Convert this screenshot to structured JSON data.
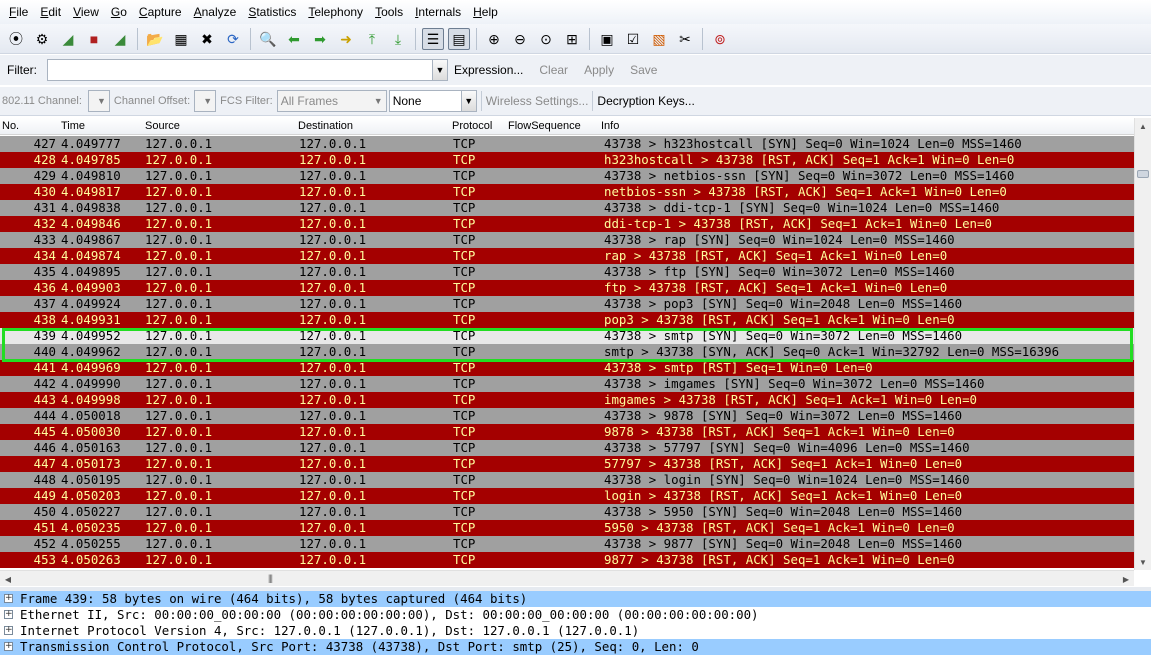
{
  "menu": [
    "File",
    "Edit",
    "View",
    "Go",
    "Capture",
    "Analyze",
    "Statistics",
    "Telephony",
    "Tools",
    "Internals",
    "Help"
  ],
  "toolbar_icons": [
    {
      "name": "interfaces-icon",
      "glyph": "⦿"
    },
    {
      "name": "options-icon",
      "glyph": "⚙"
    },
    {
      "name": "start-capture-icon",
      "glyph": "◢",
      "color": "#3a8a3a"
    },
    {
      "name": "stop-capture-icon",
      "glyph": "■",
      "color": "#b02020"
    },
    {
      "name": "restart-capture-icon",
      "glyph": "◢",
      "color": "#3a8a3a"
    },
    {
      "sep": true
    },
    {
      "name": "open-file-icon",
      "glyph": "📂"
    },
    {
      "name": "save-file-icon",
      "glyph": "▦"
    },
    {
      "name": "close-file-icon",
      "glyph": "✖"
    },
    {
      "name": "reload-icon",
      "glyph": "⟳",
      "color": "#2b66c4"
    },
    {
      "sep": true
    },
    {
      "name": "find-packet-icon",
      "glyph": "🔍"
    },
    {
      "name": "go-back-icon",
      "glyph": "⬅",
      "color": "#2f9a2f"
    },
    {
      "name": "go-forward-icon",
      "glyph": "➡",
      "color": "#2f9a2f"
    },
    {
      "name": "go-to-packet-icon",
      "glyph": "➜",
      "color": "#c9a000"
    },
    {
      "name": "first-packet-icon",
      "glyph": "⤒",
      "color": "#2f9a2f"
    },
    {
      "name": "last-packet-icon",
      "glyph": "⤓",
      "color": "#2f9a2f"
    },
    {
      "sep": true
    },
    {
      "name": "colorize-icon",
      "glyph": "☰",
      "pressed": true
    },
    {
      "name": "auto-scroll-icon",
      "glyph": "▤",
      "pressed": true
    },
    {
      "sep": true
    },
    {
      "name": "zoom-in-icon",
      "glyph": "⊕"
    },
    {
      "name": "zoom-out-icon",
      "glyph": "⊖"
    },
    {
      "name": "normal-size-icon",
      "glyph": "⊙"
    },
    {
      "name": "resize-columns-icon",
      "glyph": "⊞"
    },
    {
      "sep": true
    },
    {
      "name": "capture-filters-icon",
      "glyph": "▣"
    },
    {
      "name": "display-filters-icon",
      "glyph": "☑"
    },
    {
      "name": "coloring-rules-icon",
      "glyph": "▧",
      "color": "#d05a00"
    },
    {
      "name": "preferences-icon",
      "glyph": "✂"
    },
    {
      "sep": true
    },
    {
      "name": "help-icon",
      "glyph": "⊚",
      "color": "#c02020"
    }
  ],
  "filterbar": {
    "label": "Filter:",
    "value": "",
    "links": [
      {
        "label": "Expression...",
        "enabled": true
      },
      {
        "label": "Clear",
        "enabled": false
      },
      {
        "label": "Apply",
        "enabled": false
      },
      {
        "label": "Save",
        "enabled": false
      }
    ]
  },
  "wireless": {
    "channel_label": "802.11 Channel:",
    "offset_label": "Channel Offset:",
    "fcs_label": "FCS Filter:",
    "fcs_value": "All Frames",
    "decrypt_mode": "None",
    "settings_link": "Wireless Settings...",
    "keys_button": "Decryption Keys..."
  },
  "columns": [
    "No.",
    "Time",
    "Source",
    "Destination",
    "Protocol",
    "FlowSequence",
    "Info"
  ],
  "packets": [
    {
      "no": "427",
      "time": "4.049777",
      "src": "127.0.0.1",
      "dst": "127.0.0.1",
      "proto": "TCP",
      "info": "43738 > h323hostcall [SYN] Seq=0 Win=1024 Len=0 MSS=1460",
      "color": "gray"
    },
    {
      "no": "428",
      "time": "4.049785",
      "src": "127.0.0.1",
      "dst": "127.0.0.1",
      "proto": "TCP",
      "info": "h323hostcall > 43738 [RST, ACK] Seq=1 Ack=1 Win=0 Len=0",
      "color": "red"
    },
    {
      "no": "429",
      "time": "4.049810",
      "src": "127.0.0.1",
      "dst": "127.0.0.1",
      "proto": "TCP",
      "info": "43738 > netbios-ssn [SYN] Seq=0 Win=3072 Len=0 MSS=1460",
      "color": "gray"
    },
    {
      "no": "430",
      "time": "4.049817",
      "src": "127.0.0.1",
      "dst": "127.0.0.1",
      "proto": "TCP",
      "info": "netbios-ssn > 43738 [RST, ACK] Seq=1 Ack=1 Win=0 Len=0",
      "color": "red"
    },
    {
      "no": "431",
      "time": "4.049838",
      "src": "127.0.0.1",
      "dst": "127.0.0.1",
      "proto": "TCP",
      "info": "43738 > ddi-tcp-1 [SYN] Seq=0 Win=1024 Len=0 MSS=1460",
      "color": "gray"
    },
    {
      "no": "432",
      "time": "4.049846",
      "src": "127.0.0.1",
      "dst": "127.0.0.1",
      "proto": "TCP",
      "info": "ddi-tcp-1 > 43738 [RST, ACK] Seq=1 Ack=1 Win=0 Len=0",
      "color": "red"
    },
    {
      "no": "433",
      "time": "4.049867",
      "src": "127.0.0.1",
      "dst": "127.0.0.1",
      "proto": "TCP",
      "info": "43738 > rap [SYN] Seq=0 Win=1024 Len=0 MSS=1460",
      "color": "gray"
    },
    {
      "no": "434",
      "time": "4.049874",
      "src": "127.0.0.1",
      "dst": "127.0.0.1",
      "proto": "TCP",
      "info": "rap > 43738 [RST, ACK] Seq=1 Ack=1 Win=0 Len=0",
      "color": "red"
    },
    {
      "no": "435",
      "time": "4.049895",
      "src": "127.0.0.1",
      "dst": "127.0.0.1",
      "proto": "TCP",
      "info": "43738 > ftp [SYN] Seq=0 Win=3072 Len=0 MSS=1460",
      "color": "gray"
    },
    {
      "no": "436",
      "time": "4.049903",
      "src": "127.0.0.1",
      "dst": "127.0.0.1",
      "proto": "TCP",
      "info": "ftp > 43738 [RST, ACK] Seq=1 Ack=1 Win=0 Len=0",
      "color": "red"
    },
    {
      "no": "437",
      "time": "4.049924",
      "src": "127.0.0.1",
      "dst": "127.0.0.1",
      "proto": "TCP",
      "info": "43738 > pop3 [SYN] Seq=0 Win=2048 Len=0 MSS=1460",
      "color": "gray"
    },
    {
      "no": "438",
      "time": "4.049931",
      "src": "127.0.0.1",
      "dst": "127.0.0.1",
      "proto": "TCP",
      "info": "pop3 > 43738 [RST, ACK] Seq=1 Ack=1 Win=0 Len=0",
      "color": "red"
    },
    {
      "no": "439",
      "time": "4.049952",
      "src": "127.0.0.1",
      "dst": "127.0.0.1",
      "proto": "TCP",
      "info": "43738 > smtp [SYN] Seq=0 Win=3072 Len=0 MSS=1460",
      "color": "sel-gray"
    },
    {
      "no": "440",
      "time": "4.049962",
      "src": "127.0.0.1",
      "dst": "127.0.0.1",
      "proto": "TCP",
      "info": "smtp > 43738 [SYN, ACK] Seq=0 Ack=1 Win=32792 Len=0 MSS=16396",
      "color": "gray"
    },
    {
      "no": "441",
      "time": "4.049969",
      "src": "127.0.0.1",
      "dst": "127.0.0.1",
      "proto": "TCP",
      "info": "43738 > smtp [RST] Seq=1 Win=0 Len=0",
      "color": "red"
    },
    {
      "no": "442",
      "time": "4.049990",
      "src": "127.0.0.1",
      "dst": "127.0.0.1",
      "proto": "TCP",
      "info": "43738 > imgames [SYN] Seq=0 Win=3072 Len=0 MSS=1460",
      "color": "gray"
    },
    {
      "no": "443",
      "time": "4.049998",
      "src": "127.0.0.1",
      "dst": "127.0.0.1",
      "proto": "TCP",
      "info": "imgames > 43738 [RST, ACK] Seq=1 Ack=1 Win=0 Len=0",
      "color": "red"
    },
    {
      "no": "444",
      "time": "4.050018",
      "src": "127.0.0.1",
      "dst": "127.0.0.1",
      "proto": "TCP",
      "info": "43738 > 9878 [SYN] Seq=0 Win=3072 Len=0 MSS=1460",
      "color": "gray"
    },
    {
      "no": "445",
      "time": "4.050030",
      "src": "127.0.0.1",
      "dst": "127.0.0.1",
      "proto": "TCP",
      "info": "9878 > 43738 [RST, ACK] Seq=1 Ack=1 Win=0 Len=0",
      "color": "red"
    },
    {
      "no": "446",
      "time": "4.050163",
      "src": "127.0.0.1",
      "dst": "127.0.0.1",
      "proto": "TCP",
      "info": "43738 > 57797 [SYN] Seq=0 Win=4096 Len=0 MSS=1460",
      "color": "gray"
    },
    {
      "no": "447",
      "time": "4.050173",
      "src": "127.0.0.1",
      "dst": "127.0.0.1",
      "proto": "TCP",
      "info": "57797 > 43738 [RST, ACK] Seq=1 Ack=1 Win=0 Len=0",
      "color": "red"
    },
    {
      "no": "448",
      "time": "4.050195",
      "src": "127.0.0.1",
      "dst": "127.0.0.1",
      "proto": "TCP",
      "info": "43738 > login [SYN] Seq=0 Win=1024 Len=0 MSS=1460",
      "color": "gray"
    },
    {
      "no": "449",
      "time": "4.050203",
      "src": "127.0.0.1",
      "dst": "127.0.0.1",
      "proto": "TCP",
      "info": "login > 43738 [RST, ACK] Seq=1 Ack=1 Win=0 Len=0",
      "color": "red"
    },
    {
      "no": "450",
      "time": "4.050227",
      "src": "127.0.0.1",
      "dst": "127.0.0.1",
      "proto": "TCP",
      "info": "43738 > 5950 [SYN] Seq=0 Win=2048 Len=0 MSS=1460",
      "color": "gray"
    },
    {
      "no": "451",
      "time": "4.050235",
      "src": "127.0.0.1",
      "dst": "127.0.0.1",
      "proto": "TCP",
      "info": "5950 > 43738 [RST, ACK] Seq=1 Ack=1 Win=0 Len=0",
      "color": "red"
    },
    {
      "no": "452",
      "time": "4.050255",
      "src": "127.0.0.1",
      "dst": "127.0.0.1",
      "proto": "TCP",
      "info": "43738 > 9877 [SYN] Seq=0 Win=2048 Len=0 MSS=1460",
      "color": "gray"
    },
    {
      "no": "453",
      "time": "4.050263",
      "src": "127.0.0.1",
      "dst": "127.0.0.1",
      "proto": "TCP",
      "info": "9877 > 43738 [RST, ACK] Seq=1 Ack=1 Win=0 Len=0",
      "color": "red"
    }
  ],
  "details": [
    {
      "text": "Frame 439: 58 bytes on wire (464 bits), 58 bytes captured (464 bits)",
      "highlight": true
    },
    {
      "text": "Ethernet II, Src: 00:00:00_00:00:00 (00:00:00:00:00:00), Dst: 00:00:00_00:00:00 (00:00:00:00:00:00)",
      "highlight": false
    },
    {
      "text": "Internet Protocol Version 4, Src: 127.0.0.1 (127.0.0.1), Dst: 127.0.0.1 (127.0.0.1)",
      "highlight": false
    },
    {
      "text": "Transmission Control Protocol, Src Port: 43738 (43738), Dst Port: smtp (25), Seq: 0, Len: 0",
      "highlight": true
    }
  ],
  "colors": {
    "row_gray": "#a0a0a0",
    "row_red": "#a40000",
    "row_red_text": "#fffc9c",
    "highlight_box": "#22dd22",
    "detail_highlight": "#99ccff"
  }
}
